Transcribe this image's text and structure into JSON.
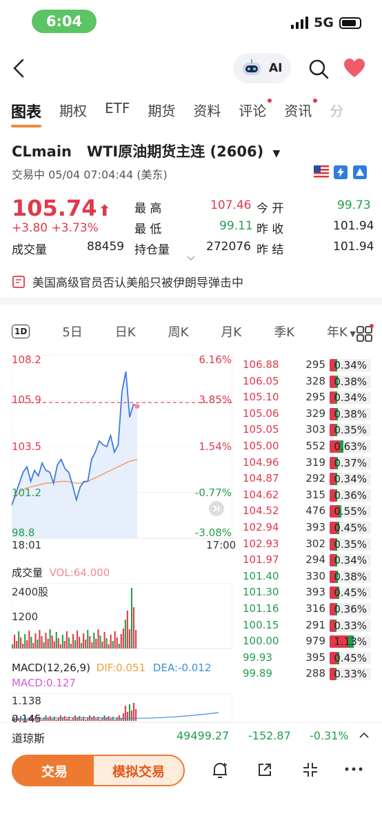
{
  "status_bar": {
    "time": "6:04",
    "network": "5G"
  },
  "nav": {
    "ai_label": "AI"
  },
  "tabs": [
    {
      "label": "图表",
      "active": true,
      "dot": false
    },
    {
      "label": "期权",
      "active": false,
      "dot": false
    },
    {
      "label": "ETF",
      "active": false,
      "dot": false
    },
    {
      "label": "期货",
      "active": false,
      "dot": false
    },
    {
      "label": "资料",
      "active": false,
      "dot": false
    },
    {
      "label": "评论",
      "active": false,
      "dot": true
    },
    {
      "label": "资讯",
      "active": false,
      "dot": true
    },
    {
      "label": "分",
      "active": false,
      "dot": false
    }
  ],
  "ticker": {
    "title": "CLmain   WTI原油期货主连 (2606)",
    "status_line": "交易中 05/04 07:04:44 (美东)",
    "price": "105.74",
    "change": "+3.80",
    "change_pct": "+3.73%",
    "volume_label": "成交量",
    "volume_value": "88459"
  },
  "quote": {
    "high_label": "最 高",
    "high": "107.46",
    "low_label": "最 低",
    "low": "99.11",
    "oi_label": "持仓量",
    "oi": "272076",
    "open_label": "今 开",
    "open": "99.73",
    "prev_close_label": "昨 收",
    "prev_close": "101.94",
    "prev_settle_label": "昨 结",
    "prev_settle": "101.94"
  },
  "news_headline": "美国高级官员否认美船只被伊朗导弹击中",
  "periods": [
    "1D",
    "5日",
    "日K",
    "周K",
    "月K",
    "季K",
    "年K"
  ],
  "chart_labels": {
    "y_left": [
      "108.2",
      "105.9",
      "103.5",
      "101.2",
      "98.8"
    ],
    "y_right": [
      "6.16%",
      "3.85%",
      "1.54%",
      "-0.77%",
      "-3.08%"
    ],
    "x_start": "18:01",
    "x_end": "17:00"
  },
  "volume_section": {
    "title": "成交量",
    "vol_label": "VOL:64.000",
    "max_label": "2400股",
    "mid_label": "1200"
  },
  "macd_section": {
    "title": "MACD(12,26,9)",
    "dif": "DIF:0.051",
    "dea": "DEA:-0.012",
    "macd": "MACD:0.127",
    "top": "1.138",
    "mid": "0.145"
  },
  "chart_data": {
    "type": "line",
    "title": "",
    "x_range": [
      "18:01",
      "17:00"
    ],
    "ylim": [
      98.8,
      108.2
    ],
    "prev_close": 101.94,
    "series": [
      {
        "values": [
          100.3,
          100.9,
          101.5,
          102.1,
          102.4,
          101.6,
          102.2,
          101.9,
          102.6,
          102.2,
          102.1,
          101.5,
          102.5,
          102.8,
          102.3,
          102.1,
          101.4,
          100.6,
          101.3,
          101.6,
          101.6,
          102.8,
          103.2,
          103.8,
          103.6,
          103.5,
          104.1,
          103.2,
          103.6,
          106.5,
          107.6,
          105.1,
          105.8,
          105.7
        ]
      },
      {
        "values": [
          100.3,
          100.8,
          101.0,
          101.15,
          101.25,
          101.3,
          101.35,
          101.4,
          101.45,
          101.5,
          101.52,
          101.55,
          101.58,
          101.6,
          101.6,
          101.58,
          101.55,
          101.5,
          101.5,
          101.55,
          101.6,
          101.7,
          101.8,
          101.9,
          102.0,
          102.1,
          102.2,
          102.3,
          102.4,
          102.5,
          102.6,
          102.7,
          102.75,
          102.8
        ]
      }
    ]
  },
  "order_book": [
    {
      "price": "106.88",
      "size": "295",
      "pct": "0.34%",
      "up": true,
      "fill": 0.34
    },
    {
      "price": "106.05",
      "size": "328",
      "pct": "0.38%",
      "up": true,
      "fill": 0.38
    },
    {
      "price": "105.10",
      "size": "295",
      "pct": "0.34%",
      "up": true,
      "fill": 0.34
    },
    {
      "price": "105.06",
      "size": "329",
      "pct": "0.38%",
      "up": true,
      "fill": 0.38
    },
    {
      "price": "105.05",
      "size": "303",
      "pct": "0.35%",
      "up": true,
      "fill": 0.35
    },
    {
      "price": "105.00",
      "size": "552",
      "pct": "0.63%",
      "up": true,
      "fill": 0.63
    },
    {
      "price": "104.96",
      "size": "319",
      "pct": "0.37%",
      "up": true,
      "fill": 0.37
    },
    {
      "price": "104.87",
      "size": "292",
      "pct": "0.34%",
      "up": true,
      "fill": 0.34
    },
    {
      "price": "104.62",
      "size": "315",
      "pct": "0.36%",
      "up": true,
      "fill": 0.36
    },
    {
      "price": "104.52",
      "size": "476",
      "pct": "0.55%",
      "up": true,
      "fill": 0.55
    },
    {
      "price": "102.94",
      "size": "393",
      "pct": "0.45%",
      "up": true,
      "fill": 0.45
    },
    {
      "price": "102.93",
      "size": "302",
      "pct": "0.35%",
      "up": true,
      "fill": 0.35
    },
    {
      "price": "101.97",
      "size": "294",
      "pct": "0.34%",
      "up": true,
      "fill": 0.34
    },
    {
      "price": "101.40",
      "size": "330",
      "pct": "0.38%",
      "up": false,
      "fill": 0.38
    },
    {
      "price": "101.30",
      "size": "393",
      "pct": "0.45%",
      "up": false,
      "fill": 0.45
    },
    {
      "price": "101.16",
      "size": "316",
      "pct": "0.36%",
      "up": false,
      "fill": 0.36
    },
    {
      "price": "100.15",
      "size": "291",
      "pct": "0.33%",
      "up": false,
      "fill": 0.33
    },
    {
      "price": "100.00",
      "size": "979",
      "pct": "1.13%",
      "up": false,
      "fill": 1.13
    },
    {
      "price": "99.93",
      "size": "395",
      "pct": "0.45%",
      "up": false,
      "fill": 0.45
    },
    {
      "price": "99.89",
      "size": "288",
      "pct": "0.33%",
      "up": false,
      "fill": 0.33
    }
  ],
  "bottom_ticker": {
    "name": "道琼斯",
    "value": "49499.27",
    "change": "-152.87",
    "pct": "-0.31%"
  },
  "actions": {
    "trade": "交易",
    "sim_trade": "模拟交易"
  },
  "colors": {
    "up": "#e0394a",
    "down": "#1f9e4a",
    "accent": "#ee7a32",
    "line": "#3d7be0"
  }
}
